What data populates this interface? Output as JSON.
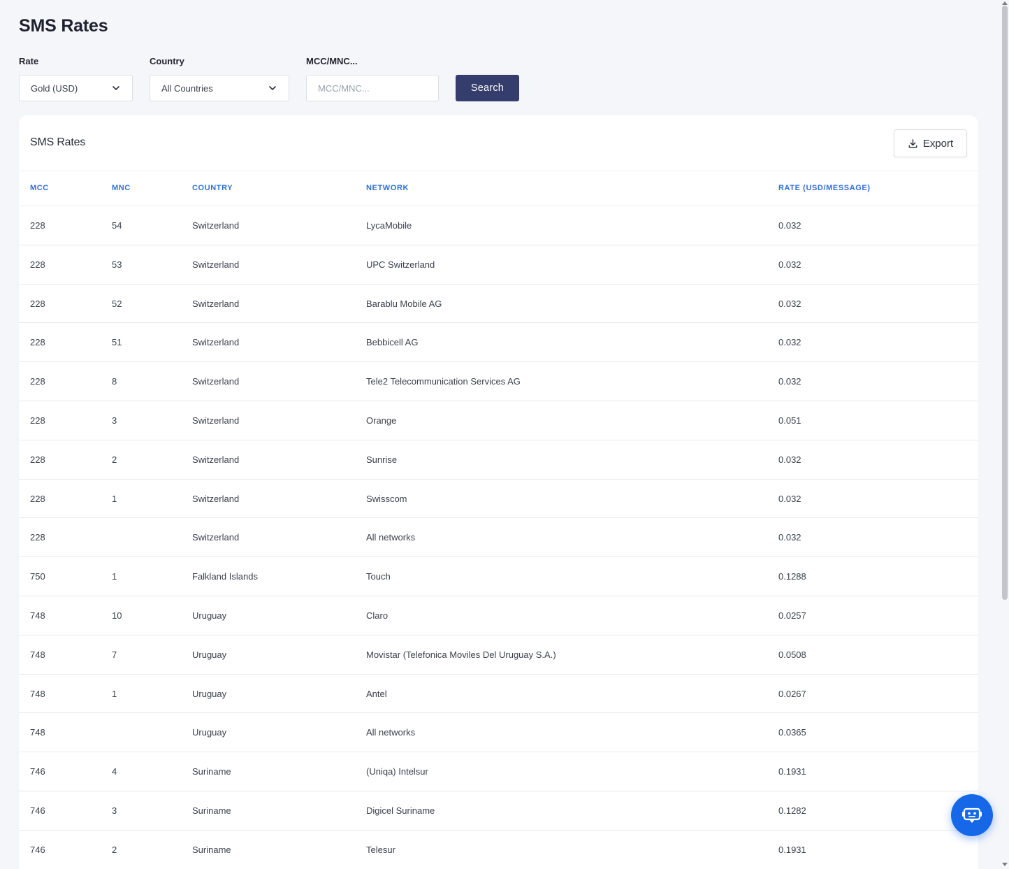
{
  "page": {
    "title": "SMS Rates"
  },
  "filters": {
    "rate": {
      "label": "Rate",
      "value": "Gold (USD)"
    },
    "country": {
      "label": "Country",
      "value": "All Countries"
    },
    "mccmnc": {
      "label": "MCC/MNC...",
      "placeholder": "MCC/MNC..."
    },
    "search_label": "Search"
  },
  "card": {
    "title": "SMS Rates",
    "export_label": "Export"
  },
  "table": {
    "columns": [
      "MCC",
      "MNC",
      "COUNTRY",
      "NETWORK",
      "RATE (USD/MESSAGE)"
    ],
    "rows": [
      [
        "228",
        "54",
        "Switzerland",
        "LycaMobile",
        "0.032"
      ],
      [
        "228",
        "53",
        "Switzerland",
        "UPC Switzerland",
        "0.032"
      ],
      [
        "228",
        "52",
        "Switzerland",
        "Barablu Mobile AG",
        "0.032"
      ],
      [
        "228",
        "51",
        "Switzerland",
        "Bebbicell AG",
        "0.032"
      ],
      [
        "228",
        "8",
        "Switzerland",
        "Tele2 Telecommunication Services AG",
        "0.032"
      ],
      [
        "228",
        "3",
        "Switzerland",
        "Orange",
        "0.051"
      ],
      [
        "228",
        "2",
        "Switzerland",
        "Sunrise",
        "0.032"
      ],
      [
        "228",
        "1",
        "Switzerland",
        "Swisscom",
        "0.032"
      ],
      [
        "228",
        "",
        "Switzerland",
        "All networks",
        "0.032"
      ],
      [
        "750",
        "1",
        "Falkland Islands",
        "Touch",
        "0.1288"
      ],
      [
        "748",
        "10",
        "Uruguay",
        "Claro",
        "0.0257"
      ],
      [
        "748",
        "7",
        "Uruguay",
        "Movistar (Telefonica Moviles Del Uruguay S.A.)",
        "0.0508"
      ],
      [
        "748",
        "1",
        "Uruguay",
        "Antel",
        "0.0267"
      ],
      [
        "748",
        "",
        "Uruguay",
        "All networks",
        "0.0365"
      ],
      [
        "746",
        "4",
        "Suriname",
        "(Uniqa) Intelsur",
        "0.1931"
      ],
      [
        "746",
        "3",
        "Suriname",
        "Digicel Suriname",
        "0.1282"
      ],
      [
        "746",
        "2",
        "Suriname",
        "Telesur",
        "0.1931"
      ]
    ]
  },
  "icons": {
    "select_chevron": "chevron-down-icon",
    "export": "download-icon",
    "chat": "chat-bot-icon"
  },
  "colors": {
    "primary_button": "#343d6b",
    "header_text": "#2f6fd6",
    "chat_button": "#1668e8"
  }
}
